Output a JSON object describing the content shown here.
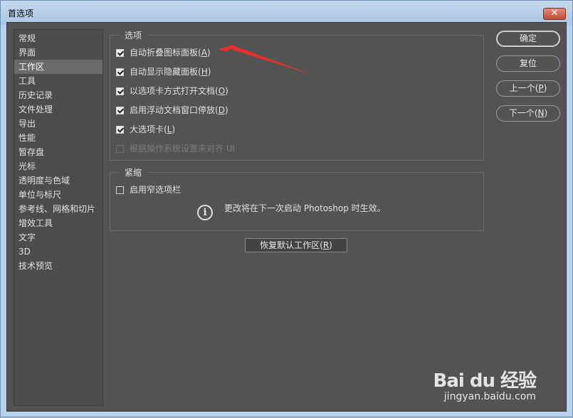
{
  "window": {
    "title": "首选项",
    "close_label": "✕"
  },
  "sidebar": {
    "items": [
      {
        "label": "常规"
      },
      {
        "label": "界面"
      },
      {
        "label": "工作区",
        "selected": true
      },
      {
        "label": "工具"
      },
      {
        "label": "历史记录"
      },
      {
        "label": "文件处理"
      },
      {
        "label": "导出"
      },
      {
        "label": "性能"
      },
      {
        "label": "暂存盘"
      },
      {
        "label": "光标"
      },
      {
        "label": "透明度与色域"
      },
      {
        "label": "单位与标尺"
      },
      {
        "label": "参考线、网格和切片"
      },
      {
        "label": "增效工具"
      },
      {
        "label": "文字"
      },
      {
        "label": "3D"
      },
      {
        "label": "技术预览"
      }
    ]
  },
  "options_group": {
    "title": "选项",
    "items": [
      {
        "text": "自动折叠图标面板(",
        "key": "A",
        "tail": ")",
        "checked": true,
        "disabled": false
      },
      {
        "text": "自动显示隐藏面板(",
        "key": "H",
        "tail": ")",
        "checked": true,
        "disabled": false
      },
      {
        "text": "以选项卡方式打开文档(",
        "key": "O",
        "tail": ")",
        "checked": true,
        "disabled": false
      },
      {
        "text": "启用浮动文档窗口停放(",
        "key": "D",
        "tail": ")",
        "checked": true,
        "disabled": false
      },
      {
        "text": "大选项卡(",
        "key": "L",
        "tail": ")",
        "checked": true,
        "disabled": false
      },
      {
        "text": "根据操作系统设置来对齐 UI",
        "key": "",
        "tail": "",
        "checked": false,
        "disabled": true
      }
    ]
  },
  "compact_group": {
    "title": "紧缩",
    "item": {
      "text": "启用窄选项栏",
      "checked": false
    },
    "notice": "更改将在下一次启动 Photoshop 时生效。",
    "notice_icon": "info-icon"
  },
  "reset_button": {
    "text": "恢复默认工作区(",
    "key": "R",
    "tail": ")"
  },
  "buttons": {
    "ok": "确定",
    "reset": "复位",
    "prev_text": "上一个(",
    "prev_key": "P",
    "prev_tail": ")",
    "next_text": "下一个(",
    "next_key": "N",
    "next_tail": ")"
  },
  "annotation": {
    "color": "#e8302a",
    "icon": "red-arrow"
  },
  "watermark": {
    "logo": "Bai du 经验",
    "url": "jingyan.baidu.com"
  }
}
